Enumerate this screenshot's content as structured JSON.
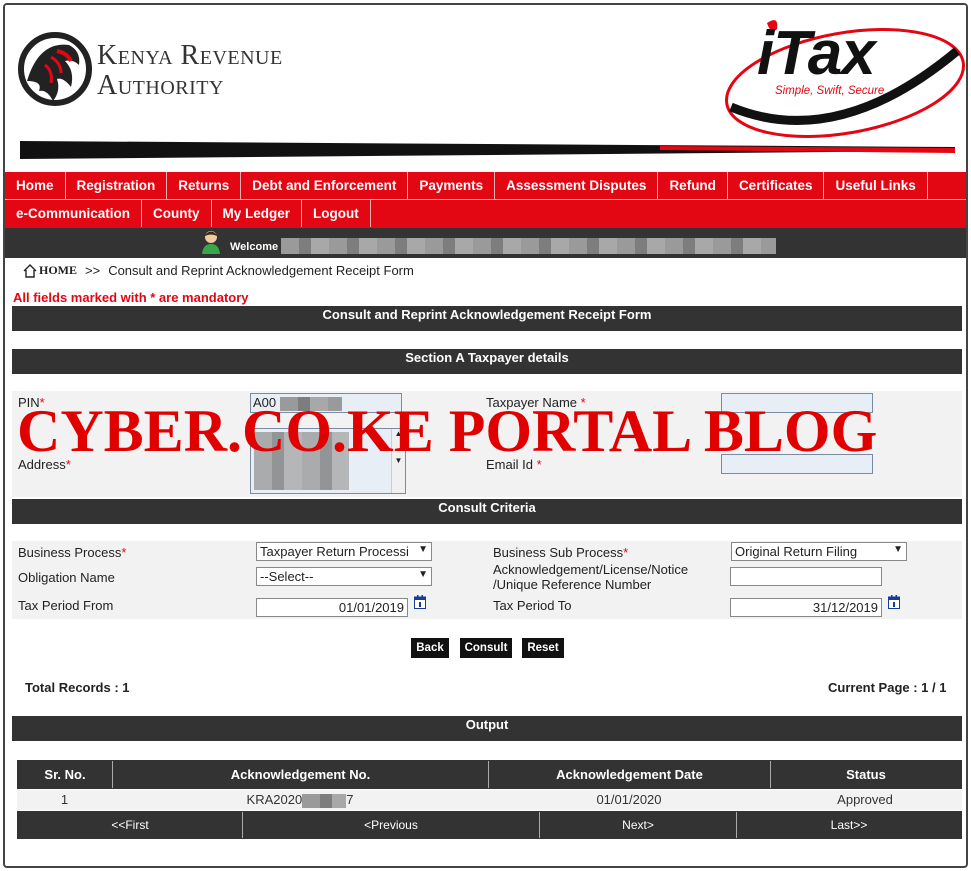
{
  "header": {
    "kra_line1": "Kenya Revenue",
    "kra_line2": "Authority",
    "itax_title": "iTax",
    "itax_tagline": "Simple, Swift, Secure"
  },
  "nav": {
    "row1": [
      "Home",
      "Registration",
      "Returns",
      "Debt and Enforcement",
      "Payments",
      "Assessment Disputes",
      "Refund",
      "Certificates",
      "Useful Links"
    ],
    "row2": [
      "e-Communication",
      "County",
      "My Ledger",
      "Logout"
    ]
  },
  "welcome": {
    "label": "Welcome"
  },
  "breadcrumb": {
    "home": "HOME",
    "sep": ">>",
    "current": "Consult and Reprint Acknowledgement Receipt Form"
  },
  "mandatory_note": "All fields marked with * are mandatory",
  "form_title": "Consult and Reprint Acknowledgement Receipt Form",
  "section_a": {
    "title": "Section A Taxpayer details",
    "pin_label": "PIN",
    "pin_value": "A00",
    "taxpayer_name_label": "Taxpayer Name",
    "address_label": "Address",
    "email_label": "Email Id"
  },
  "consult": {
    "title": "Consult Criteria",
    "business_process_label": "Business Process",
    "business_process_value": "Taxpayer Return Processi",
    "business_sub_process_label": "Business Sub Process",
    "business_sub_process_value": "Original Return Filing",
    "obligation_label": "Obligation Name",
    "obligation_value": "--Select--",
    "ack_label_1": "Acknowledgement/License/Notice",
    "ack_label_2": "/Unique Reference Number",
    "period_from_label": "Tax Period From",
    "period_from_value": "01/01/2019",
    "period_to_label": "Tax Period To",
    "period_to_value": "31/12/2019"
  },
  "buttons": {
    "back": "Back",
    "consult": "Consult",
    "reset": "Reset"
  },
  "records": {
    "total": "Total Records : 1",
    "page": "Current Page : 1 / 1"
  },
  "output": {
    "title": "Output",
    "columns": [
      "Sr. No.",
      "Acknowledgement No.",
      "Acknowledgement Date",
      "Status"
    ],
    "rows": [
      {
        "sr": "1",
        "ack_prefix": "KRA2020",
        "ack_suffix": "7",
        "date": "01/01/2020",
        "status": "Approved"
      }
    ],
    "pager": [
      "<<First",
      "<Previous",
      "Next>",
      "Last>>"
    ]
  },
  "watermark": "CYBER.CO.KE PORTAL BLOG",
  "colors": {
    "brand_red": "#e30613",
    "dark_bar": "#333333"
  }
}
